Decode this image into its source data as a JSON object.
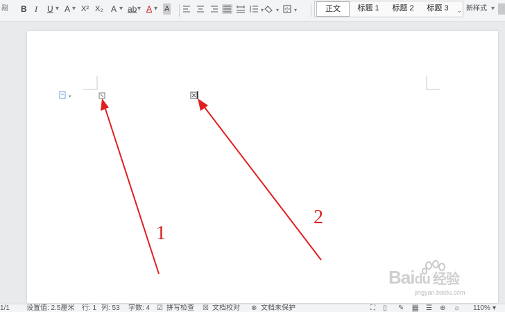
{
  "ribbon": {
    "left_cut": "剐",
    "bold": "B",
    "italic": "I",
    "underline": "U",
    "font_color_a": "A",
    "superscript": "X²",
    "subscript": "X₂",
    "text_effect": "A",
    "highlight": "ab",
    "font_color": "A",
    "char_shading": "A",
    "styles": {
      "normal": "正文",
      "heading1": "标题 1",
      "heading2": "标题 2",
      "heading3": "标题 3",
      "new_style": "新样式"
    }
  },
  "document": {
    "annotation_1": "1",
    "annotation_2": "2"
  },
  "statusbar": {
    "page": "1/1",
    "position": "设置值: 2.5厘米",
    "row": "行: 1",
    "col": "列: 53",
    "word_count": "字数: 4",
    "spell_check": "拼写检查",
    "doc_proof": "文档校对",
    "doc_unprotected": "文档未保护",
    "zoom": "110%"
  },
  "watermark": {
    "brand": "Bai",
    "brand2": "du",
    "cn": "经验",
    "url": "jingyan.baidu.com"
  },
  "colors": {
    "arrow_red": "#e02020",
    "accent_blue": "#3a7bd5"
  }
}
